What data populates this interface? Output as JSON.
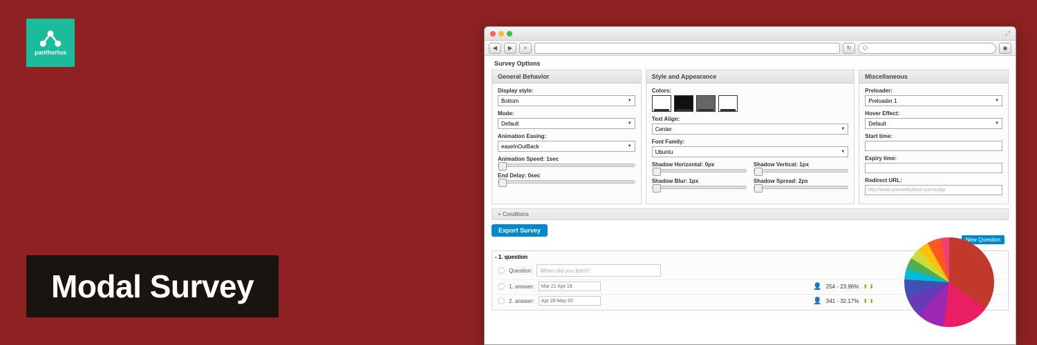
{
  "logo": {
    "name": "pantherius"
  },
  "title": "Modal Survey",
  "browserBar": {
    "searchPlaceholder": "Q-"
  },
  "surveyOptions": {
    "title": "Survey Options",
    "panels": {
      "general": {
        "title": "General Behavior",
        "displayStyle": {
          "label": "Display style:",
          "value": "Bottom"
        },
        "mode": {
          "label": "Mode:",
          "value": "Default"
        },
        "easing": {
          "label": "Animation Easing:",
          "value": "easeInOutBack"
        },
        "speed": {
          "label": "Animation Speed: 1sec"
        },
        "delay": {
          "label": "End Delay: 0sec"
        }
      },
      "style": {
        "title": "Style and Appearance",
        "colors": {
          "label": "Colors:"
        },
        "textAlign": {
          "label": "Text Align:",
          "value": "Center"
        },
        "fontFamily": {
          "label": "Font Family:",
          "value": "Ubuntu"
        },
        "shadowH": {
          "label": "Shadow Horizontal: 0px"
        },
        "shadowV": {
          "label": "Shadow Vertical: 1px"
        },
        "shadowB": {
          "label": "Shadow Blur: 1px"
        },
        "shadowS": {
          "label": "Shadow Spread: 2px"
        }
      },
      "misc": {
        "title": "Miscellaneous",
        "preloader": {
          "label": "Preloader:",
          "value": "Preloader 1"
        },
        "hover": {
          "label": "Hover Effect:",
          "value": "Default"
        },
        "start": {
          "label": "Start time:"
        },
        "expiry": {
          "label": "Expiry time:"
        },
        "redirect": {
          "label": "Redirect URL:",
          "placeholder": "http://www.yourwebsiteurl.com/subp"
        }
      }
    },
    "conditions": "+ Conditions",
    "exportBtn": "Export Survey",
    "newQuestion": "New Question",
    "question": {
      "header": "- 1. question",
      "label": "Question:",
      "placeholder": "When did you born?",
      "answers": [
        {
          "label": "1. answer:",
          "value": "Mar 21-Apr 19",
          "stat": "254 - 23.96%"
        },
        {
          "label": "2. answer:",
          "value": "Apr 20-May 20",
          "stat": "341 - 32.17%"
        }
      ]
    }
  }
}
